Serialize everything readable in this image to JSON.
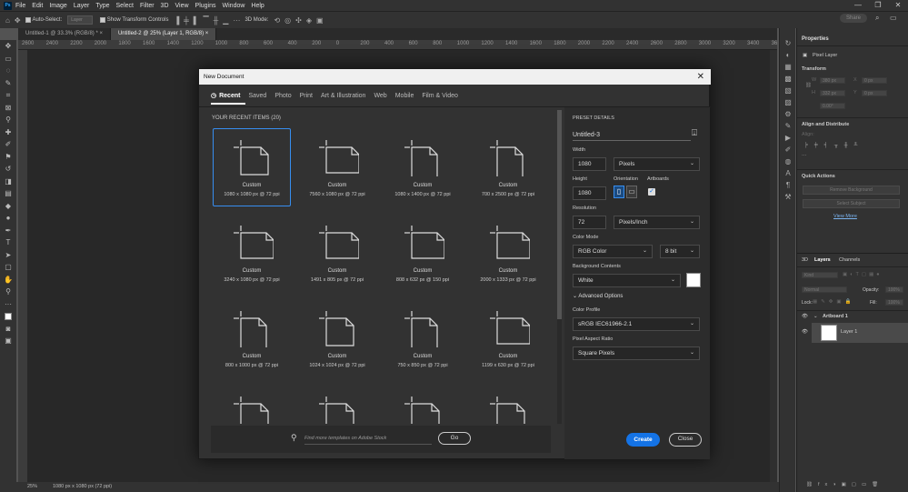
{
  "menu": [
    "File",
    "Edit",
    "Image",
    "Layer",
    "Type",
    "Select",
    "Filter",
    "3D",
    "View",
    "Plugins",
    "Window",
    "Help"
  ],
  "app_logo": "Ps",
  "window_controls": [
    "—",
    "❐",
    "✕"
  ],
  "options": {
    "auto_select": "Auto-Select:",
    "layer_select": "Layer",
    "show_transform": "Show Transform Controls",
    "mode_3d": "3D Mode:",
    "share": "Share"
  },
  "doc_tabs": [
    "Untitled-1 @ 33.3% (RGB/8) *  ×",
    "Untitled-2 @ 25% (Layer 1, RGB/8)  ×"
  ],
  "ruler": [
    "2600",
    "2400",
    "2200",
    "2000",
    "1800",
    "1600",
    "1400",
    "1200",
    "1000",
    "800",
    "600",
    "400",
    "200",
    "0",
    "200",
    "400",
    "600",
    "800",
    "1000",
    "1200",
    "1400",
    "1600",
    "1800",
    "2000",
    "2200",
    "2400",
    "2600",
    "2800",
    "3000",
    "3200",
    "3400",
    "3600"
  ],
  "status": {
    "zoom": "25%",
    "doc": "1080 px x 1080 px (72 ppi)"
  },
  "dialog": {
    "title": "New Document",
    "close": "✕",
    "tabs": [
      "Recent",
      "Saved",
      "Photo",
      "Print",
      "Art & Illustration",
      "Web",
      "Mobile",
      "Film & Video"
    ],
    "recent_heading": "YOUR RECENT ITEMS  (20)",
    "items": [
      {
        "name": "Custom",
        "dims": "1080 x 1080 px @ 72 ppi"
      },
      {
        "name": "Custom",
        "dims": "7560 x 1080 px @ 72 ppi"
      },
      {
        "name": "Custom",
        "dims": "1080 x 1400 px @ 72 ppi"
      },
      {
        "name": "Custom",
        "dims": "700 x 2500 px @ 72 ppi"
      },
      {
        "name": "Custom",
        "dims": "3240 x 1080 px @ 72 ppi"
      },
      {
        "name": "Custom",
        "dims": "1491 x 805 px @ 72 ppi"
      },
      {
        "name": "Custom",
        "dims": "808 x 632 px @ 150 ppi"
      },
      {
        "name": "Custom",
        "dims": "2000 x 1333 px @ 72 ppi"
      },
      {
        "name": "Custom",
        "dims": "800 x 1000 px @ 72 ppi"
      },
      {
        "name": "Custom",
        "dims": "1024 x 1024 px @ 72 ppi"
      },
      {
        "name": "Custom",
        "dims": "750 x 850 px @ 72 ppi"
      },
      {
        "name": "Custom",
        "dims": "1199 x 630 px @ 72 ppi"
      },
      {
        "name": "",
        "dims": ""
      },
      {
        "name": "",
        "dims": ""
      },
      {
        "name": "",
        "dims": ""
      },
      {
        "name": "",
        "dims": ""
      }
    ],
    "search_placeholder": "Find more templates on Adobe Stock",
    "go": "Go",
    "preset": {
      "heading": "PRESET DETAILS",
      "name": "Untitled-3",
      "width_label": "Width",
      "width": "1080",
      "width_unit": "Pixels",
      "height_label": "Height",
      "height": "1080",
      "orientation_label": "Orientation",
      "artboards_label": "Artboards",
      "resolution_label": "Resolution",
      "resolution": "72",
      "resolution_unit": "Pixels/Inch",
      "color_mode_label": "Color Mode",
      "color_mode": "RGB Color",
      "bit_depth": "8 bit",
      "bg_label": "Background Contents",
      "bg": "White",
      "advanced": "Advanced Options",
      "profile_label": "Color Profile",
      "profile": "sRGB IEC61966-2.1",
      "par_label": "Pixel Aspect Ratio",
      "par": "Square Pixels",
      "create": "Create",
      "close": "Close"
    }
  },
  "properties": {
    "title": "Properties",
    "pixel_layer": "Pixel Layer",
    "transform": "Transform",
    "w": "W",
    "h": "H",
    "x": "X",
    "y": "Y",
    "w_val": "380 px",
    "h_val": "332 px",
    "x_val": "0 px",
    "y_val": "0 px",
    "angle": "0.00°",
    "align": "Align and Distribute",
    "align_sub": "Align:",
    "quick": "Quick Actions",
    "remove_bg": "Remove Background",
    "select_subject": "Select Subject",
    "view_more": "View More"
  },
  "layers": {
    "tabs": [
      "3D",
      "Layers",
      "Channels"
    ],
    "kind": "Kind",
    "blend": "Normal",
    "opacity_label": "Opacity:",
    "opacity": "100%",
    "lock_label": "Lock:",
    "fill_label": "Fill:",
    "fill": "100%",
    "artboard": "Artboard 1",
    "layer1": "Layer 1"
  }
}
